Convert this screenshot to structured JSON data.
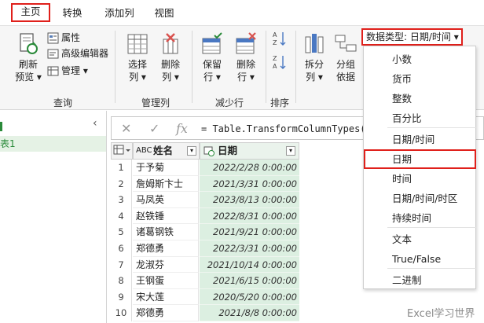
{
  "tabs": [
    {
      "label": "主页",
      "active": true
    },
    {
      "label": "转换",
      "active": false
    },
    {
      "label": "添加列",
      "active": false
    },
    {
      "label": "视图",
      "active": false
    }
  ],
  "ribbon": {
    "query": {
      "refresh": "刷新",
      "refresh2": "预览 ▾",
      "properties": "属性",
      "advanced_editor": "高级编辑器",
      "manage": "管理 ▾",
      "label": "查询"
    },
    "manage_columns": {
      "choose": "选择",
      "choose2": "列 ▾",
      "remove": "删除",
      "remove2": "列 ▾",
      "label": "管理列"
    },
    "reduce_rows": {
      "keep": "保留",
      "keep2": "行 ▾",
      "remove": "删除",
      "remove2": "行 ▾",
      "label": "减少行"
    },
    "sort": {
      "label": "排序"
    },
    "transform": {
      "split": "拆分",
      "split2": "列 ▾",
      "group": "分组",
      "group2": "依据"
    },
    "data_type_button": "数据类型: 日期/时间 ▾"
  },
  "left_panel": {
    "item": "表1"
  },
  "formula": {
    "text": "= Table.TransformColumnTypes(源"
  },
  "grid": {
    "headers": [
      "姓名",
      "日期"
    ],
    "header_type_icon_name": "ABC",
    "rows": [
      {
        "n": "1",
        "name": "于予菊",
        "date": "2022/2/28 0:00:00"
      },
      {
        "n": "2",
        "name": "詹姆斯卞士",
        "date": "2021/3/31 0:00:00"
      },
      {
        "n": "3",
        "name": "马凤英",
        "date": "2023/8/13 0:00:00"
      },
      {
        "n": "4",
        "name": "赵铁锤",
        "date": "2022/8/31 0:00:00"
      },
      {
        "n": "5",
        "name": "诸葛钢铁",
        "date": "2021/9/21 0:00:00"
      },
      {
        "n": "6",
        "name": "郑德勇",
        "date": "2022/3/31 0:00:00"
      },
      {
        "n": "7",
        "name": "龙淑芬",
        "date": "2021/10/14 0:00:00"
      },
      {
        "n": "8",
        "name": "王钢蛋",
        "date": "2021/6/15 0:00:00"
      },
      {
        "n": "9",
        "name": "宋大莲",
        "date": "2020/5/20 0:00:00"
      },
      {
        "n": "10",
        "name": "郑德勇",
        "date": "2021/8/8 0:00:00"
      }
    ]
  },
  "menu": {
    "items": [
      {
        "label": "小数",
        "selected": false
      },
      {
        "label": "货币",
        "selected": false
      },
      {
        "label": "整数",
        "selected": false
      },
      {
        "label": "百分比",
        "selected": false
      },
      {
        "label": "日期/时间",
        "selected": false
      },
      {
        "label": "日期",
        "selected": true
      },
      {
        "label": "时间",
        "selected": false
      },
      {
        "label": "日期/时间/时区",
        "selected": false
      },
      {
        "label": "持续时间",
        "selected": false
      },
      {
        "label": "文本",
        "selected": false
      },
      {
        "label": "True/False",
        "selected": false
      },
      {
        "label": "二进制",
        "selected": false
      }
    ]
  },
  "watermark": "Excel学习世界",
  "colors": {
    "highlight_red": "#e0201b",
    "date_column_green": "#dcefe1",
    "query_green": "#2a8a3a"
  }
}
